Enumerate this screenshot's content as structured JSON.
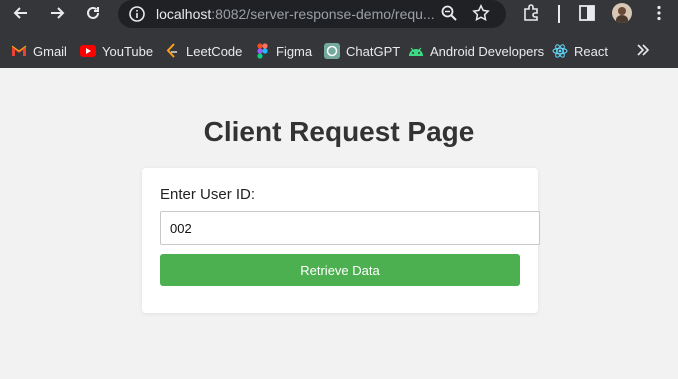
{
  "browser": {
    "url_host": "localhost",
    "url_rest": ":8082/server-response-demo/requ..."
  },
  "bookmarks": [
    {
      "label": "Gmail",
      "icon": "gmail-icon"
    },
    {
      "label": "YouTube",
      "icon": "youtube-icon"
    },
    {
      "label": "LeetCode",
      "icon": "leetcode-icon"
    },
    {
      "label": "Figma",
      "icon": "figma-icon"
    },
    {
      "label": "ChatGPT",
      "icon": "chatgpt-icon"
    },
    {
      "label": "Android Developers",
      "icon": "android-icon"
    },
    {
      "label": "React",
      "icon": "react-icon"
    }
  ],
  "page": {
    "title": "Client Request Page",
    "user_id_label": "Enter User ID:",
    "user_id_value": "002",
    "retrieve_button": "Retrieve Data"
  },
  "colors": {
    "button": "#4caf50",
    "chrome": "#35363a",
    "page_bg": "#f2f2f2"
  }
}
